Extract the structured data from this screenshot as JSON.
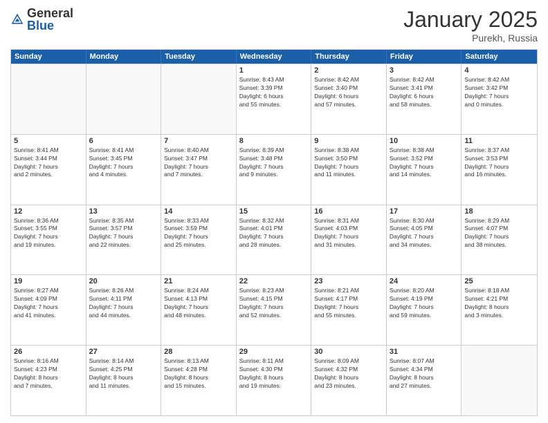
{
  "header": {
    "logo_general": "General",
    "logo_blue": "Blue",
    "month": "January 2025",
    "location": "Purekh, Russia"
  },
  "days_of_week": [
    "Sunday",
    "Monday",
    "Tuesday",
    "Wednesday",
    "Thursday",
    "Friday",
    "Saturday"
  ],
  "rows": [
    [
      {
        "day": "",
        "info": ""
      },
      {
        "day": "",
        "info": ""
      },
      {
        "day": "",
        "info": ""
      },
      {
        "day": "1",
        "info": "Sunrise: 8:43 AM\nSunset: 3:39 PM\nDaylight: 6 hours\nand 55 minutes."
      },
      {
        "day": "2",
        "info": "Sunrise: 8:42 AM\nSunset: 3:40 PM\nDaylight: 6 hours\nand 57 minutes."
      },
      {
        "day": "3",
        "info": "Sunrise: 8:42 AM\nSunset: 3:41 PM\nDaylight: 6 hours\nand 58 minutes."
      },
      {
        "day": "4",
        "info": "Sunrise: 8:42 AM\nSunset: 3:42 PM\nDaylight: 7 hours\nand 0 minutes."
      }
    ],
    [
      {
        "day": "5",
        "info": "Sunrise: 8:41 AM\nSunset: 3:44 PM\nDaylight: 7 hours\nand 2 minutes."
      },
      {
        "day": "6",
        "info": "Sunrise: 8:41 AM\nSunset: 3:45 PM\nDaylight: 7 hours\nand 4 minutes."
      },
      {
        "day": "7",
        "info": "Sunrise: 8:40 AM\nSunset: 3:47 PM\nDaylight: 7 hours\nand 7 minutes."
      },
      {
        "day": "8",
        "info": "Sunrise: 8:39 AM\nSunset: 3:48 PM\nDaylight: 7 hours\nand 9 minutes."
      },
      {
        "day": "9",
        "info": "Sunrise: 8:38 AM\nSunset: 3:50 PM\nDaylight: 7 hours\nand 11 minutes."
      },
      {
        "day": "10",
        "info": "Sunrise: 8:38 AM\nSunset: 3:52 PM\nDaylight: 7 hours\nand 14 minutes."
      },
      {
        "day": "11",
        "info": "Sunrise: 8:37 AM\nSunset: 3:53 PM\nDaylight: 7 hours\nand 16 minutes."
      }
    ],
    [
      {
        "day": "12",
        "info": "Sunrise: 8:36 AM\nSunset: 3:55 PM\nDaylight: 7 hours\nand 19 minutes."
      },
      {
        "day": "13",
        "info": "Sunrise: 8:35 AM\nSunset: 3:57 PM\nDaylight: 7 hours\nand 22 minutes."
      },
      {
        "day": "14",
        "info": "Sunrise: 8:33 AM\nSunset: 3:59 PM\nDaylight: 7 hours\nand 25 minutes."
      },
      {
        "day": "15",
        "info": "Sunrise: 8:32 AM\nSunset: 4:01 PM\nDaylight: 7 hours\nand 28 minutes."
      },
      {
        "day": "16",
        "info": "Sunrise: 8:31 AM\nSunset: 4:03 PM\nDaylight: 7 hours\nand 31 minutes."
      },
      {
        "day": "17",
        "info": "Sunrise: 8:30 AM\nSunset: 4:05 PM\nDaylight: 7 hours\nand 34 minutes."
      },
      {
        "day": "18",
        "info": "Sunrise: 8:29 AM\nSunset: 4:07 PM\nDaylight: 7 hours\nand 38 minutes."
      }
    ],
    [
      {
        "day": "19",
        "info": "Sunrise: 8:27 AM\nSunset: 4:09 PM\nDaylight: 7 hours\nand 41 minutes."
      },
      {
        "day": "20",
        "info": "Sunrise: 8:26 AM\nSunset: 4:11 PM\nDaylight: 7 hours\nand 44 minutes."
      },
      {
        "day": "21",
        "info": "Sunrise: 8:24 AM\nSunset: 4:13 PM\nDaylight: 7 hours\nand 48 minutes."
      },
      {
        "day": "22",
        "info": "Sunrise: 8:23 AM\nSunset: 4:15 PM\nDaylight: 7 hours\nand 52 minutes."
      },
      {
        "day": "23",
        "info": "Sunrise: 8:21 AM\nSunset: 4:17 PM\nDaylight: 7 hours\nand 55 minutes."
      },
      {
        "day": "24",
        "info": "Sunrise: 8:20 AM\nSunset: 4:19 PM\nDaylight: 7 hours\nand 59 minutes."
      },
      {
        "day": "25",
        "info": "Sunrise: 8:18 AM\nSunset: 4:21 PM\nDaylight: 8 hours\nand 3 minutes."
      }
    ],
    [
      {
        "day": "26",
        "info": "Sunrise: 8:16 AM\nSunset: 4:23 PM\nDaylight: 8 hours\nand 7 minutes."
      },
      {
        "day": "27",
        "info": "Sunrise: 8:14 AM\nSunset: 4:25 PM\nDaylight: 8 hours\nand 11 minutes."
      },
      {
        "day": "28",
        "info": "Sunrise: 8:13 AM\nSunset: 4:28 PM\nDaylight: 8 hours\nand 15 minutes."
      },
      {
        "day": "29",
        "info": "Sunrise: 8:11 AM\nSunset: 4:30 PM\nDaylight: 8 hours\nand 19 minutes."
      },
      {
        "day": "30",
        "info": "Sunrise: 8:09 AM\nSunset: 4:32 PM\nDaylight: 8 hours\nand 23 minutes."
      },
      {
        "day": "31",
        "info": "Sunrise: 8:07 AM\nSunset: 4:34 PM\nDaylight: 8 hours\nand 27 minutes."
      },
      {
        "day": "",
        "info": ""
      }
    ]
  ]
}
